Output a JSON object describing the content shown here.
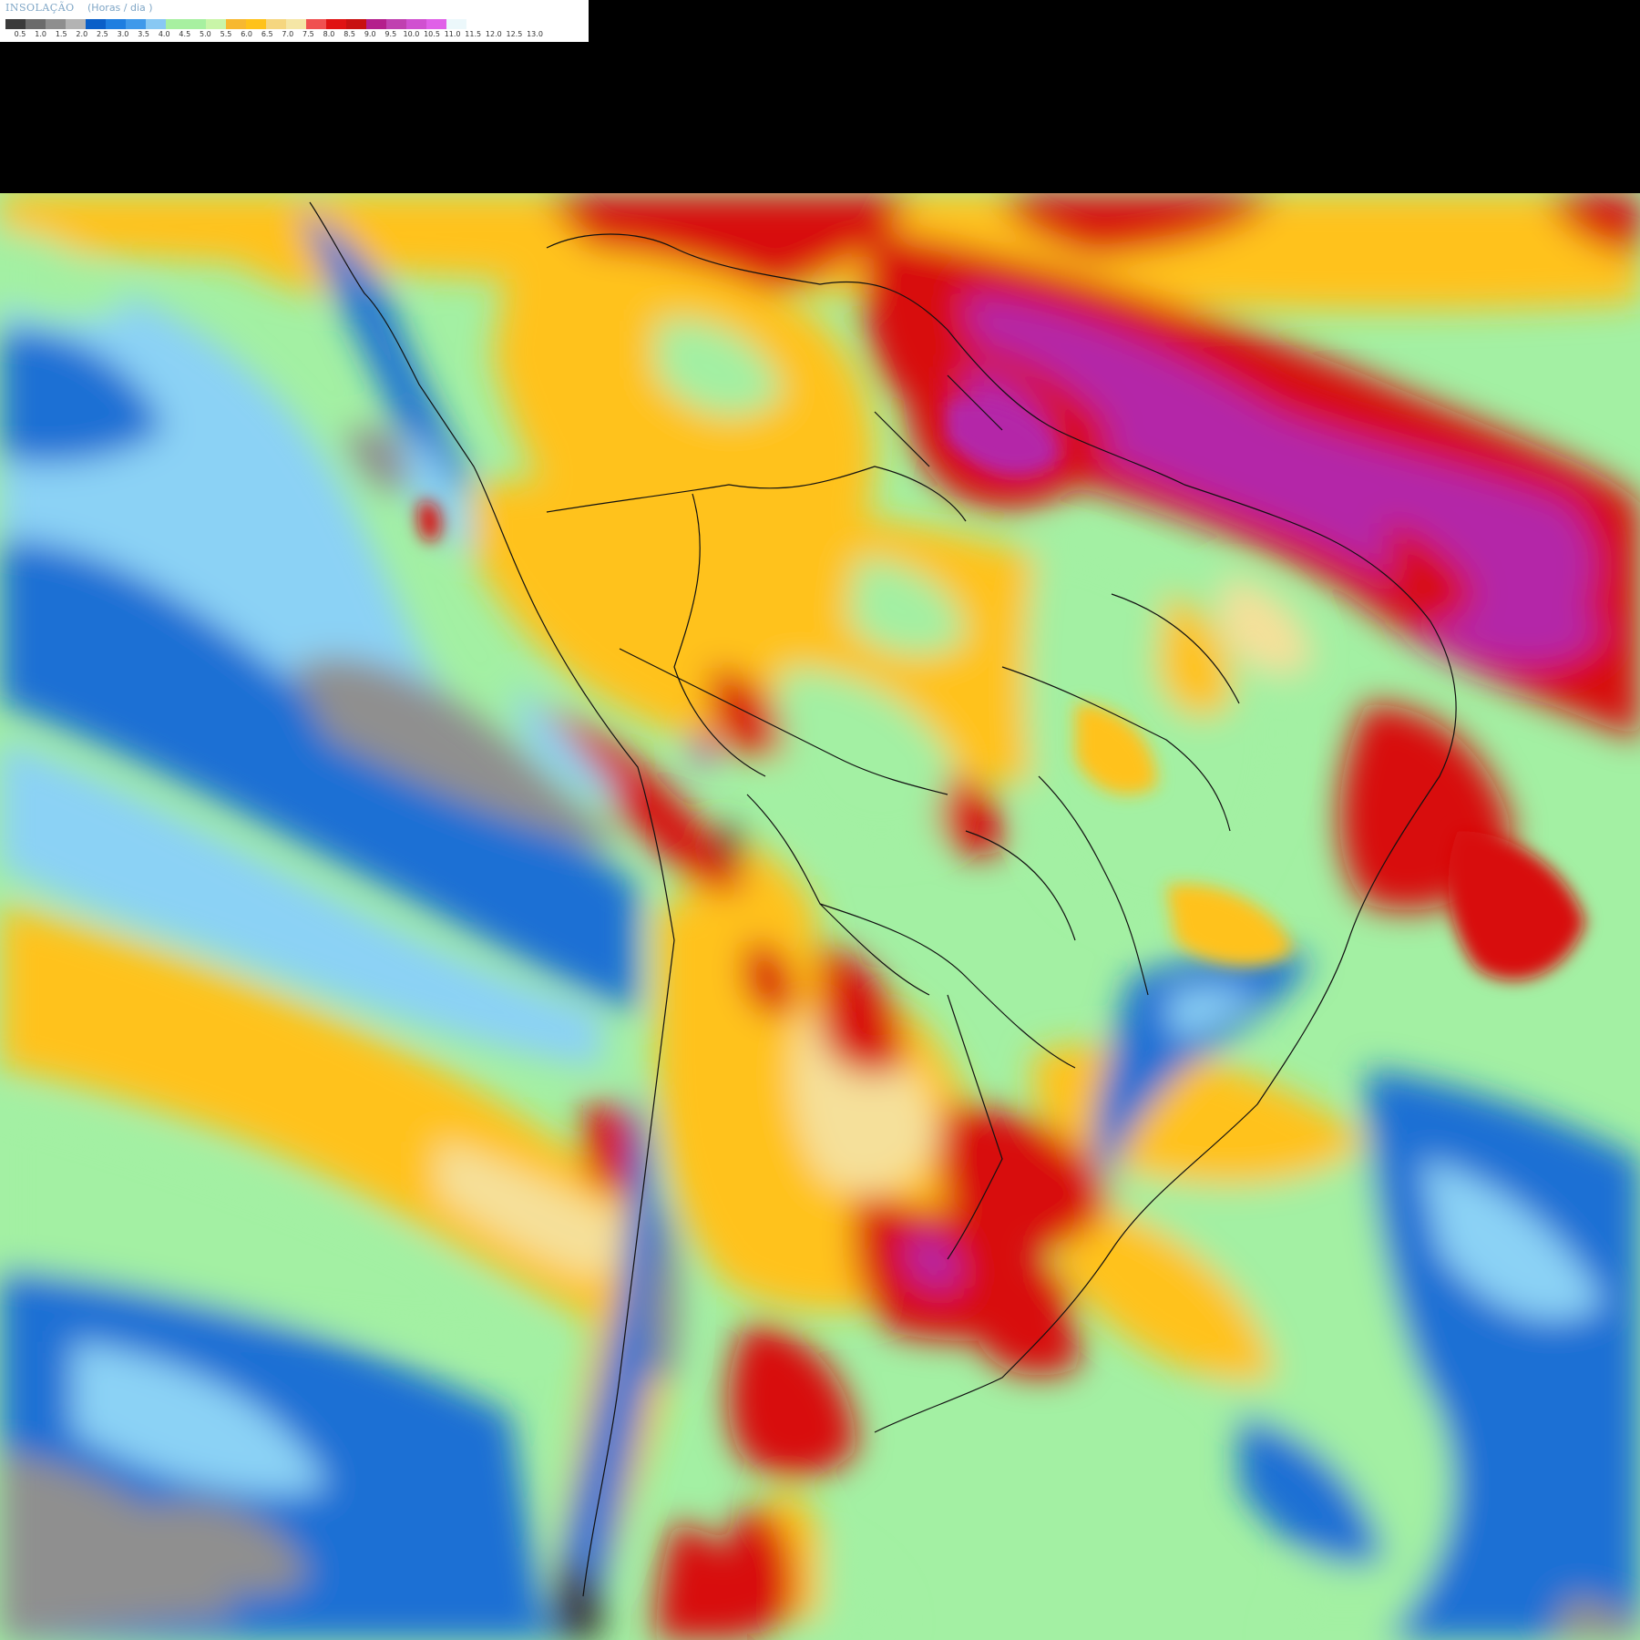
{
  "legend": {
    "title": "INSOLAÇÃO",
    "unit": "(Horas / dia )",
    "colors": [
      "#3a3a3a",
      "#6b6b6b",
      "#8e8e8e",
      "#b3b3b3",
      "#0a5fc8",
      "#1e7ee0",
      "#3f99ea",
      "#88c8f3",
      "#a7f0a0",
      "#a7f0a0",
      "#c9f5a8",
      "#f7b830",
      "#ffc21a",
      "#f5d680",
      "#f5e6a6",
      "#f05050",
      "#e01212",
      "#c81010",
      "#b41e8c",
      "#c040b0",
      "#d050d0",
      "#e060e8",
      "#ecf8fb",
      "#ffffff"
    ],
    "ticks": [
      "0.5",
      "1.0",
      "1.5",
      "2.0",
      "2.5",
      "3.0",
      "3.5",
      "4.0",
      "4.5",
      "5.0",
      "5.5",
      "6.0",
      "6.5",
      "7.0",
      "7.5",
      "8.0",
      "8.5",
      "9.0",
      "9.5",
      "10.0",
      "10.5",
      "11.0",
      "11.5",
      "12.0",
      "12.5",
      "13.0"
    ]
  },
  "map": {
    "region": "South America",
    "variable": "Insolação (horas/dia)",
    "palette": {
      "ocean_base": "#7fd6ff",
      "very_low": "#8f8f8f",
      "low": "#1a6fd4",
      "medium_low": "#8bd2f5",
      "medium": "#a3f0a3",
      "medium_high": "#ffc21a",
      "high": "#f5e09a",
      "very_high": "#d81010",
      "extreme": "#b428a8"
    }
  }
}
